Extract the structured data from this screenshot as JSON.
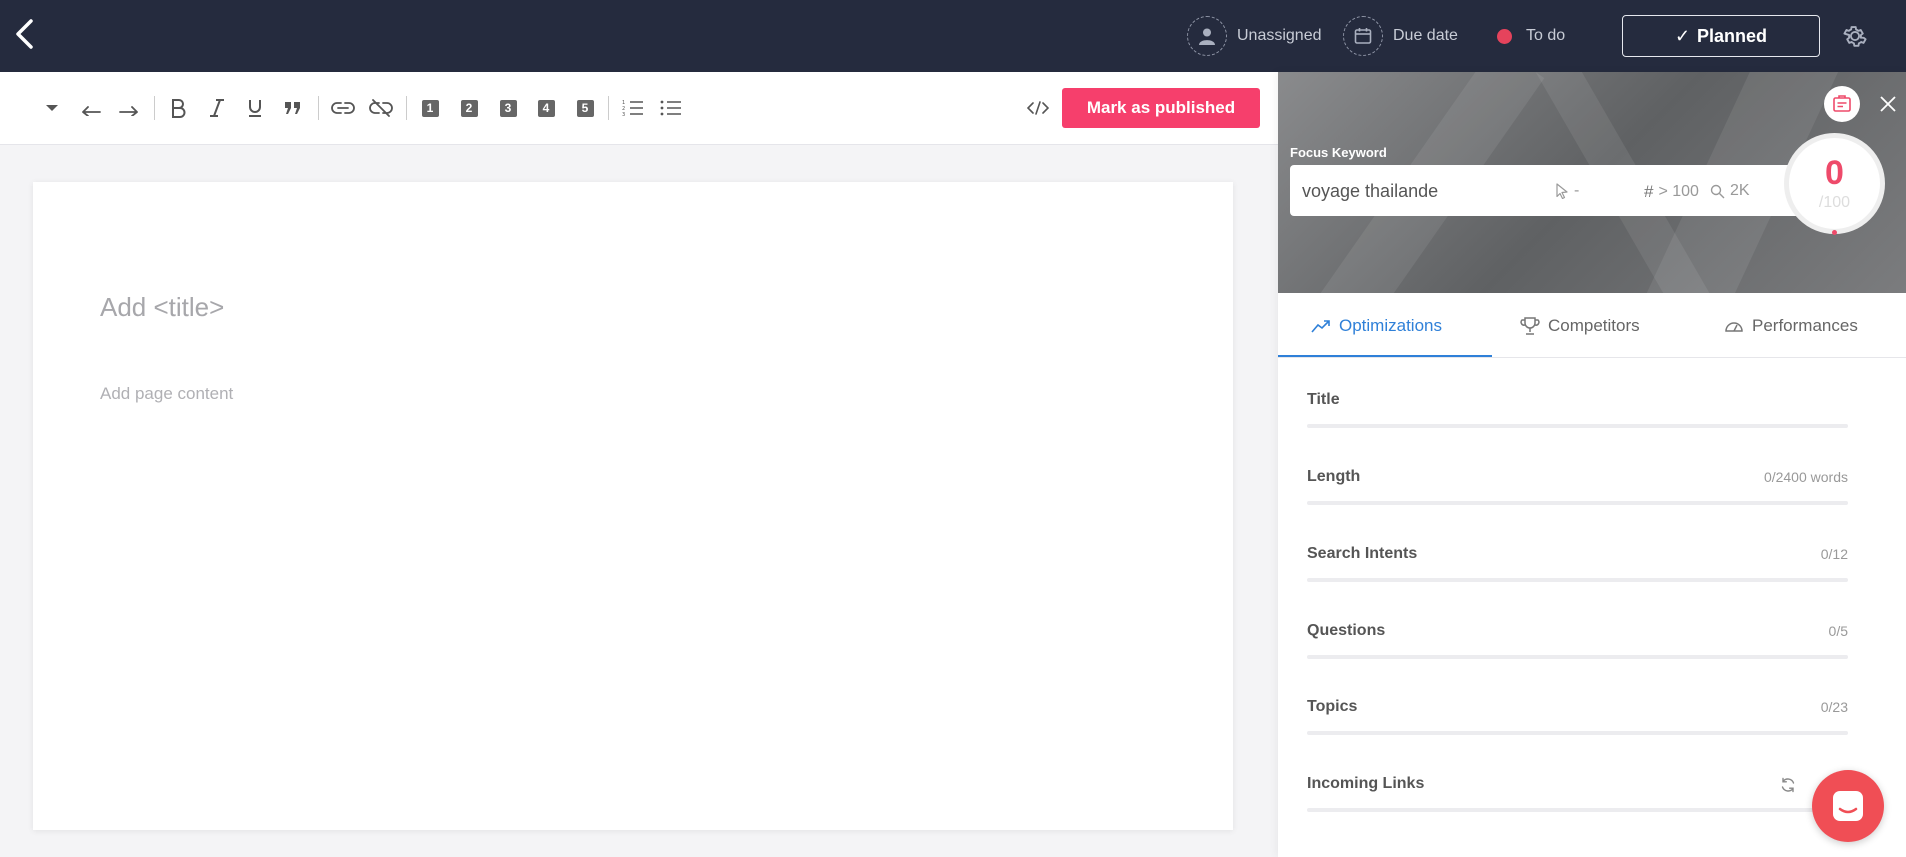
{
  "topbar": {
    "assignee": "Unassigned",
    "due_date": "Due date",
    "status": "To do",
    "status_color": "#e5435c",
    "planned_label": "Planned"
  },
  "toolbar": {
    "heading_levels": [
      "1",
      "2",
      "3",
      "4",
      "5"
    ],
    "publish_label": "Mark as published",
    "publish_color": "#f63f6c"
  },
  "editor": {
    "title_placeholder": "Add <title>",
    "content_placeholder": "Add page content"
  },
  "panel": {
    "focus_label": "Focus Keyword",
    "keyword": "voyage thailande",
    "clicks": "-",
    "rank": "> 100",
    "volume": "2K",
    "score": "0",
    "score_max": "/100",
    "tabs": [
      {
        "label": "Optimizations",
        "active": true
      },
      {
        "label": "Competitors",
        "active": false
      },
      {
        "label": "Performances",
        "active": false
      }
    ],
    "sections": [
      {
        "name": "Title",
        "count": ""
      },
      {
        "name": "Length",
        "count": "0/2400 words"
      },
      {
        "name": "Search Intents",
        "count": "0/12"
      },
      {
        "name": "Questions",
        "count": "0/5"
      },
      {
        "name": "Topics",
        "count": "0/23"
      },
      {
        "name": "Incoming Links",
        "count": ""
      }
    ],
    "accent_color": "#2f80d8"
  }
}
